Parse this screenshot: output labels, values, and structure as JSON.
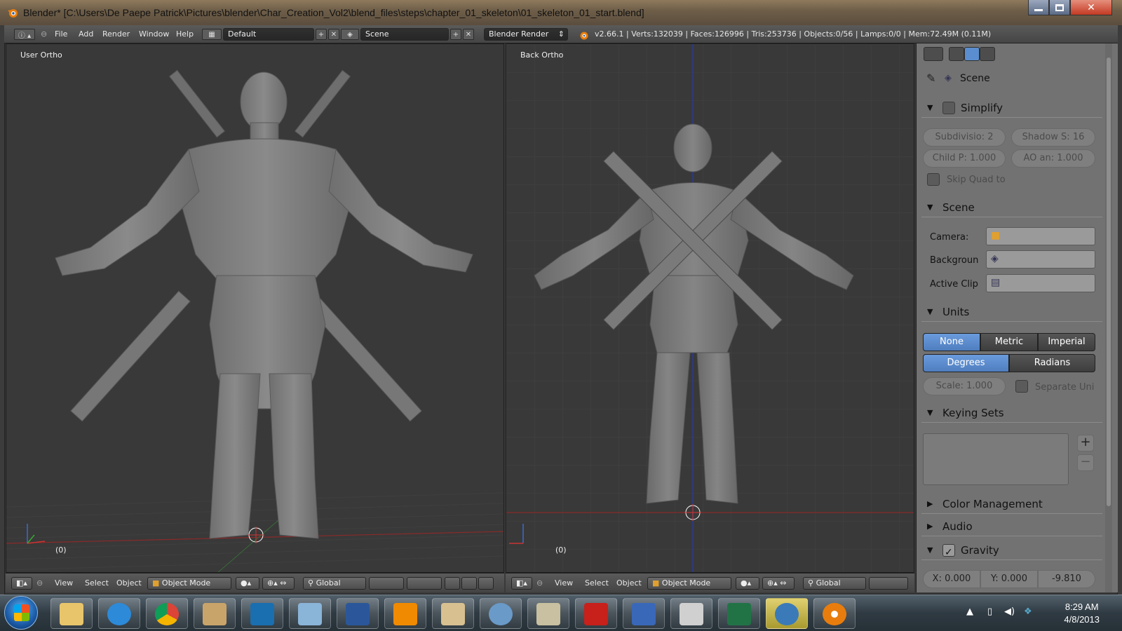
{
  "window": {
    "title": "Blender* [C:\\Users\\De Paepe Patrick\\Pictures\\blender\\Char_Creation_Vol2\\blend_files\\steps\\chapter_01_skeleton\\01_skeleton_01_start.blend]",
    "min_icon": "minimize-icon",
    "max_icon": "maximize-icon",
    "close_symbol": "✕"
  },
  "menu": {
    "items": [
      "File",
      "Add",
      "Render",
      "Window",
      "Help"
    ]
  },
  "screen_layout": "Default",
  "scene_name": "Scene",
  "render_engine": "Blender Render",
  "stats": "v2.66.1 | Verts:132039 | Faces:126996 | Tris:253736 | Objects:0/56 | Lamps:0/0 | Mem:72.49M (0.11M)",
  "viewports": [
    {
      "label": "User Ortho",
      "frame": "(0)"
    },
    {
      "label": "Back Ortho",
      "frame": "(0)"
    }
  ],
  "viewport_header": {
    "menus": [
      "View",
      "Select",
      "Object"
    ],
    "mode": "Object Mode",
    "orientation": "Global"
  },
  "properties": {
    "context": "Scene",
    "simplify": {
      "title": "Simplify",
      "subdivision": "Subdivisio: 2",
      "shadow_samples": "Shadow S: 16",
      "child_particles": "Child P: 1.000",
      "ao_bounces": "AO an: 1.000",
      "skip_quad": "Skip Quad to"
    },
    "scene": {
      "title": "Scene",
      "camera_label": "Camera:",
      "background_label": "Backgroun",
      "active_clip_label": "Active Clip"
    },
    "units": {
      "title": "Units",
      "systems": [
        "None",
        "Metric",
        "Imperial"
      ],
      "rotation": [
        "Degrees",
        "Radians"
      ],
      "scale": "Scale: 1.000",
      "separate": "Separate Uni"
    },
    "keying_sets": {
      "title": "Keying Sets",
      "add": "+",
      "remove": "−"
    },
    "color_management": "Color Management",
    "audio": "Audio",
    "gravity": {
      "title": "Gravity",
      "x": "X: 0.000",
      "y": "Y: 0.000",
      "z": "-9.810"
    }
  },
  "taskbar": {
    "apps": [
      "explorer-icon",
      "ie-icon",
      "chrome-icon",
      "mail-icon",
      "hp-icon",
      "monitor-icon",
      "word-icon",
      "vlc-icon",
      "photos-icon",
      "speed-icon",
      "paint-icon",
      "pdf-icon",
      "castle-icon",
      "files-icon",
      "excel-icon",
      "bs-icon",
      "blender-icon"
    ],
    "time": "8:29 AM",
    "date": "4/8/2013"
  },
  "colors": {
    "accent": "#5b8ed0",
    "viewport_bg": "#393939",
    "panel_bg": "#727272"
  }
}
